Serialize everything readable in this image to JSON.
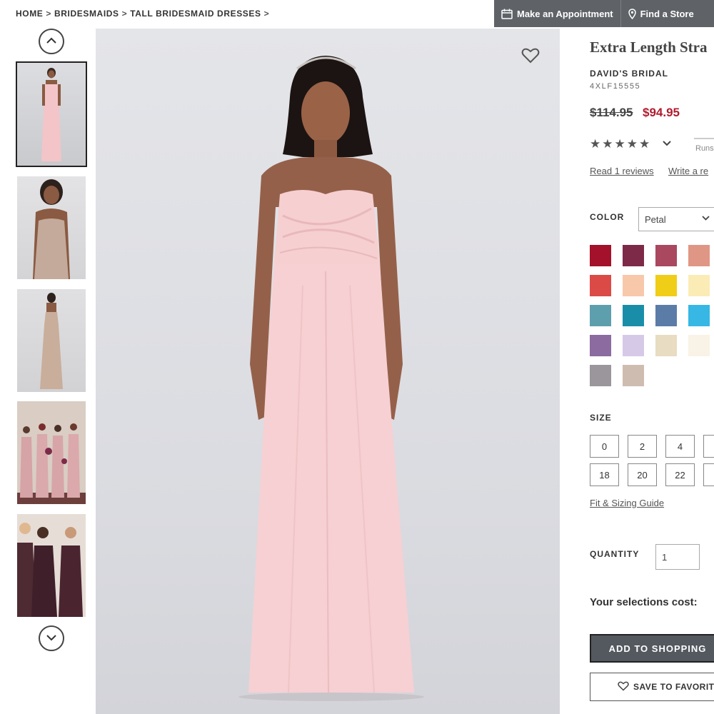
{
  "breadcrumb": [
    {
      "label": "HOME"
    },
    {
      "label": "BRIDESMAIDS"
    },
    {
      "label": "TALL BRIDESMAID DRESSES"
    }
  ],
  "breadcrumb_separator": ">",
  "top_actions": {
    "appointment": "Make an Appointment",
    "find_store": "Find a Store"
  },
  "product": {
    "title": "Extra Length Stra",
    "brand": "DAVID'S BRIDAL",
    "sku": "4XLF15555",
    "original_price": "$114.95",
    "sale_price": "$94.95",
    "rating_stars": "★★★★★",
    "fit_note": "Runs",
    "read_reviews": "Read 1 reviews",
    "write_review": "Write a re"
  },
  "color": {
    "label": "COLOR",
    "selected": "Petal",
    "swatches": [
      "#a3112a",
      "#7d2a49",
      "#a9485f",
      "#e09684",
      "#db4a46",
      "#f8c8ab",
      "#f0cd17",
      "#fbecb6",
      "#5e9fae",
      "#1a8ea8",
      "#5c7ca8",
      "#37b8e4",
      "#8b6ba0",
      "#d6c9e8",
      "#e8dcc2",
      "#f8f3e6",
      "#9b969b",
      "#cfbcb0"
    ]
  },
  "size": {
    "label": "SIZE",
    "options": [
      "0",
      "2",
      "4",
      "",
      "18",
      "20",
      "22",
      ""
    ],
    "guide": "Fit & Sizing Guide"
  },
  "quantity": {
    "label": "QUANTITY",
    "value": "1"
  },
  "selections_cost_label": "Your selections cost:",
  "add_to_bag": "ADD TO SHOPPING",
  "save_favorite": "SAVE TO FAVORITE",
  "icons": {
    "arrow_up": "chevron-up-icon",
    "arrow_down": "chevron-down-icon",
    "favorite": "heart-icon",
    "calendar": "calendar-icon",
    "location": "map-pin-icon"
  },
  "colors": {
    "sale_red": "#b01c2e",
    "action_dark": "#545960",
    "top_bar_gray": "#5f6368"
  }
}
